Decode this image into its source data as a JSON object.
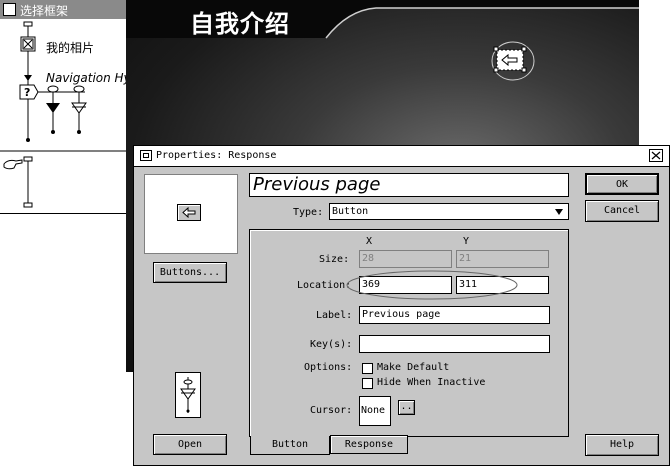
{
  "flowline": {
    "title": "选择框架",
    "icon1_label": "我的相片",
    "icon2_label": "Navigation Hyperlink"
  },
  "stage": {
    "title": "自我介绍"
  },
  "dialog": {
    "title": "Properties: Response",
    "name_value": "Previous page",
    "type_label": "Type:",
    "type_value": "Button",
    "ok_label": "OK",
    "cancel_label": "Cancel",
    "help_label": "Help",
    "buttons_label": "Buttons...",
    "open_label": "Open",
    "x_header": "X",
    "y_header": "Y",
    "size_label": "Size:",
    "size_x": "28",
    "size_y": "21",
    "location_label": "Location:",
    "location_x": "369",
    "location_y": "311",
    "label_label": "Label:",
    "label_value": "Previous page",
    "keys_label": "Key(s):",
    "keys_value": "",
    "options_label": "Options:",
    "option1": "Make Default",
    "option2": "Hide When Inactive",
    "cursor_label": "Cursor:",
    "cursor_value": "None",
    "cursor_btn": "..",
    "tab_button": "Button",
    "tab_response": "Response"
  }
}
